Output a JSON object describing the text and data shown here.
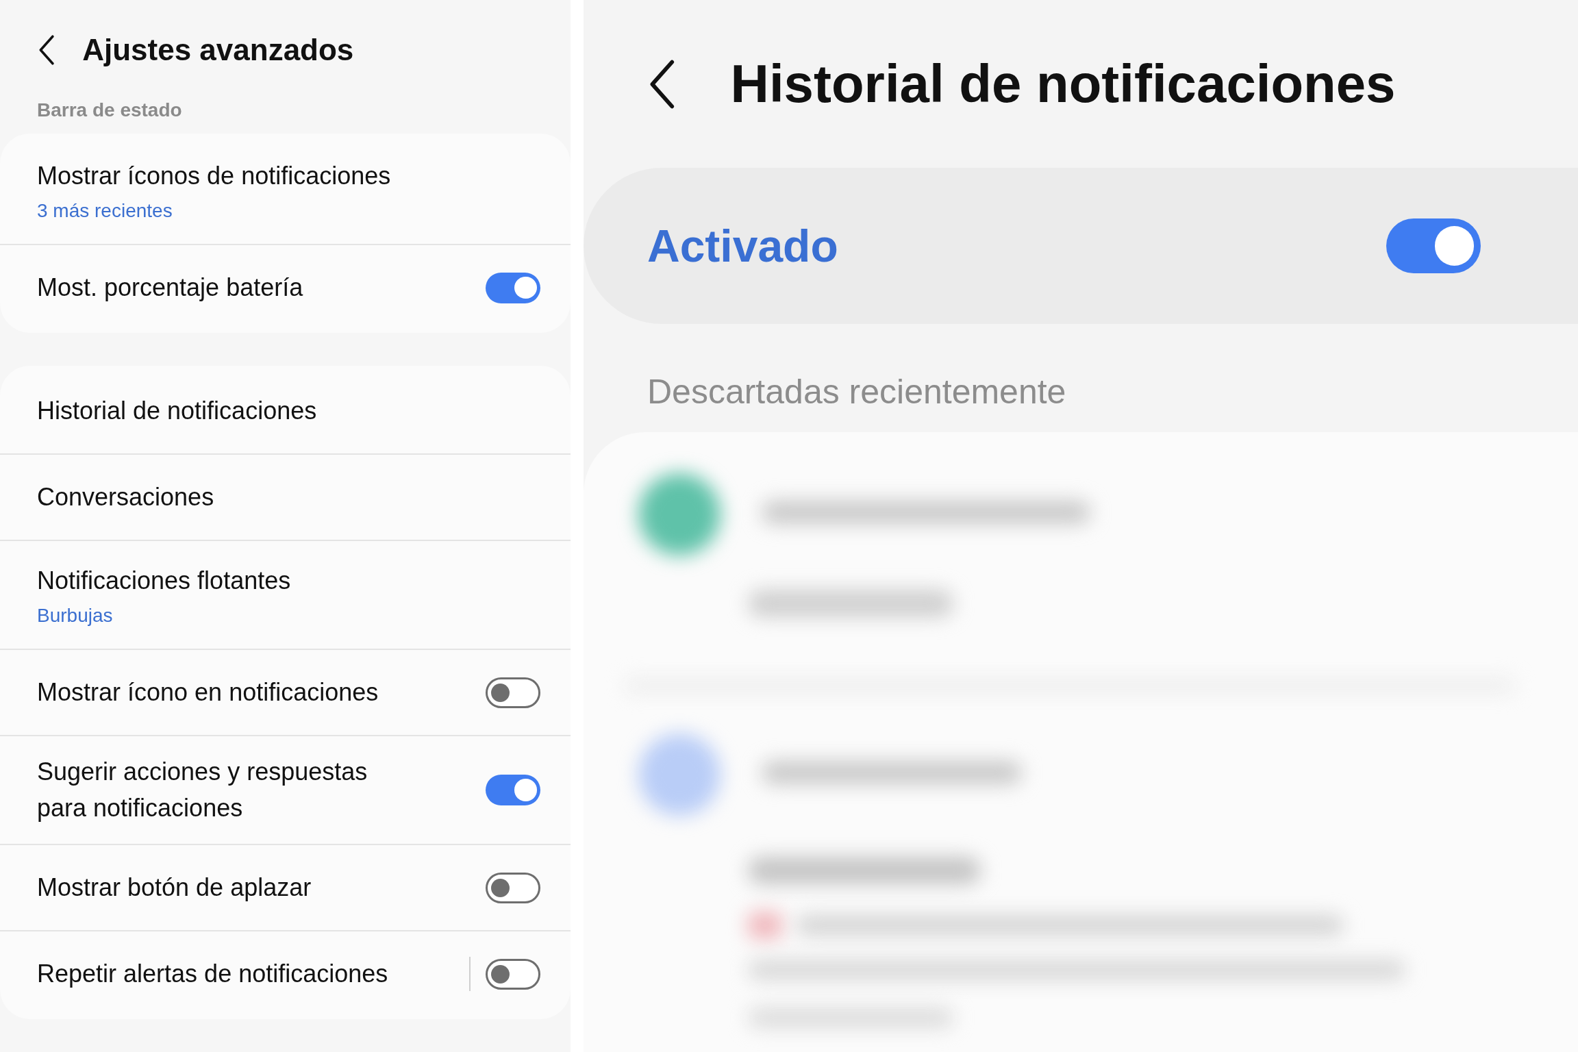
{
  "left": {
    "title": "Ajustes avanzados",
    "section": "Barra de estado",
    "groups": [
      {
        "rows": [
          {
            "kind": "link",
            "label": "Mostrar íconos de notificaciones",
            "subtitle": "3 más recientes"
          },
          {
            "kind": "toggle",
            "label": "Most. porcentaje batería",
            "on": true
          }
        ]
      },
      {
        "rows": [
          {
            "kind": "link",
            "label": "Historial de notificaciones"
          },
          {
            "kind": "link",
            "label": "Conversaciones"
          },
          {
            "kind": "link",
            "label": "Notificaciones flotantes",
            "subtitle": "Burbujas"
          },
          {
            "kind": "toggle",
            "label": "Mostrar ícono en notificaciones",
            "on": false
          },
          {
            "kind": "toggle",
            "label": "Sugerir acciones y respuestas para notificaciones",
            "on": true
          },
          {
            "kind": "toggle",
            "label": "Mostrar botón de aplazar",
            "on": false
          },
          {
            "kind": "split-toggle",
            "label": "Repetir alertas de notificaciones",
            "on": false
          }
        ]
      }
    ]
  },
  "right": {
    "title": "Historial de notificaciones",
    "master": {
      "label": "Activado",
      "on": true
    },
    "section": "Descartadas recientemente"
  }
}
